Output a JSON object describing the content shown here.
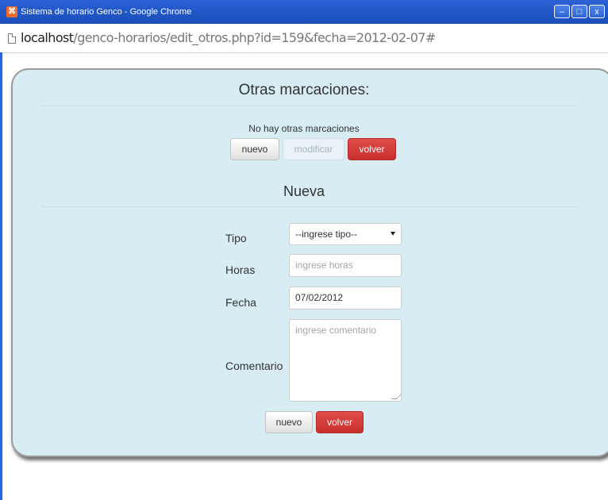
{
  "window": {
    "title": "Sistema de horario Genco - Google Chrome",
    "app_icon": "grid-app-icon",
    "controls": [
      "minimize-icon",
      "maximize-icon",
      "close-icon"
    ]
  },
  "address": {
    "host": "localhost",
    "path": "/genco-horarios/edit_otros.php?id=159&fecha=2012-02-07#"
  },
  "otras": {
    "heading": "Otras marcaciones:",
    "empty_message": "No hay otras marcaciones",
    "buttons": {
      "nuevo": "nuevo",
      "modificar": "modificar",
      "volver": "volver"
    }
  },
  "nueva": {
    "heading": "Nueva",
    "tipo": {
      "label": "Tipo",
      "selected": "--ingrese tipo--"
    },
    "horas": {
      "label": "Horas",
      "placeholder": "ingrese horas"
    },
    "fecha": {
      "label": "Fecha",
      "value": "07/02/2012"
    },
    "comentario": {
      "label": "Comentario",
      "placeholder": "ingrese comentario"
    },
    "buttons": {
      "nuevo": "nuevo",
      "volver": "volver"
    }
  },
  "colors": {
    "panel_bg": "#d8ecf4",
    "danger": "#d13d3a",
    "titlebar": "#2257c9"
  }
}
